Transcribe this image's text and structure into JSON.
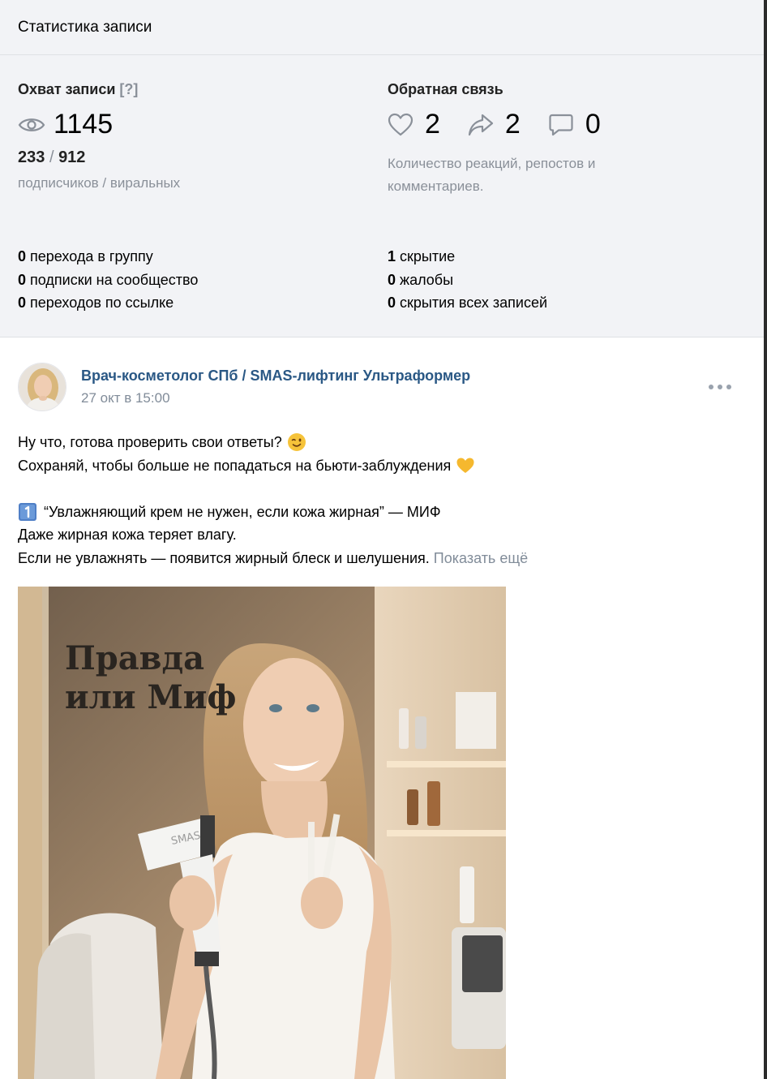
{
  "header": {
    "title": "Статистика записи"
  },
  "reach": {
    "title": "Охват записи",
    "help": "[?]",
    "total": "1145",
    "subscribers": "233",
    "separator": "/",
    "viral": "912",
    "sub_label": "подписчиков / виральных"
  },
  "feedback": {
    "title": "Обратная связь",
    "likes": "2",
    "reposts": "2",
    "comments": "0",
    "description": "Количество реакций, репостов и комментариев."
  },
  "left_metrics": [
    {
      "value": "0",
      "label": "перехода в группу"
    },
    {
      "value": "0",
      "label": "подписки на сообщество"
    },
    {
      "value": "0",
      "label": "переходов по ссылке"
    }
  ],
  "right_metrics": [
    {
      "value": "1",
      "label": "скрытие"
    },
    {
      "value": "0",
      "label": "жалобы"
    },
    {
      "value": "0",
      "label": "скрытия всех записей"
    }
  ],
  "post": {
    "author": "Врач-косметолог СПб / SMAS-лифтинг Ультраформер",
    "date": "27 окт в 15:00",
    "lines": [
      "Ну что, готова проверить свои ответы?",
      "Сохраняй, чтобы больше не попадаться на бьюти-заблуждения",
      "“Увлажняющий крем не нужен, если кожа жирная” — МИФ",
      "Даже жирная кожа теряет влагу.",
      "Если не увлажнять — появится жирный блеск и шелушения."
    ],
    "show_more": "Показать ещё",
    "image": {
      "title_line1": "Правда",
      "title_line2": "или Миф",
      "device_label": "SMAS"
    }
  },
  "colors": {
    "link": "#2a5885",
    "muted": "#818c99",
    "panel_bg": "#f2f3f6",
    "divider": "#dfe1e5"
  },
  "icons": [
    "eye-icon",
    "heart-icon",
    "repost-icon",
    "comment-icon",
    "more-icon",
    "wink-emoji-icon",
    "yellow-heart-emoji-icon",
    "keycap-one-emoji-icon"
  ]
}
